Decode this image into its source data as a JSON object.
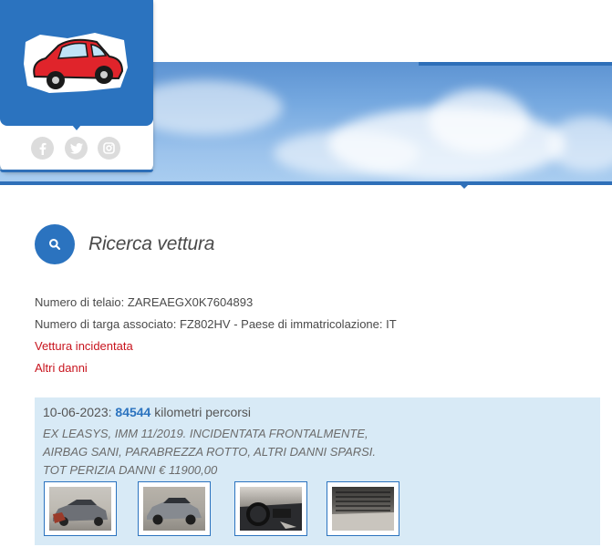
{
  "brand": {
    "logo_icon": "red-car-icon",
    "accent_color": "#2b73bf",
    "alert_color": "#c8141e"
  },
  "social": [
    {
      "icon": "facebook-icon",
      "glyph": "f"
    },
    {
      "icon": "twitter-icon",
      "glyph": "t"
    },
    {
      "icon": "instagram-icon",
      "glyph": "◎"
    }
  ],
  "search": {
    "icon": "search-icon",
    "title": "Ricerca vettura"
  },
  "vehicle": {
    "chassis_line": "Numero di telaio: ZAREAEGX0K7604893",
    "plate_line": "Numero di targa associato: FZ802HV - Paese di immatricolazione: IT",
    "flag_accident": "Vettura incidentata",
    "flag_other_damage": "Altri danni"
  },
  "record": {
    "date": "10-06-2023:",
    "km": "84544",
    "km_label": "kilometri percorsi",
    "desc_line1": "EX LEASYS, IMM 11/2019. INCIDENTATA FRONTALMENTE,",
    "desc_line2": "AIRBAG SANI, PARABREZZA ROTTO, ALTRI DANNI SPARSI.",
    "desc_line3": "TOT PERIZIA DANNI € 11900,00",
    "photos": [
      {
        "name": "photo-front-damage"
      },
      {
        "name": "photo-side-view"
      },
      {
        "name": "photo-interior-dashboard"
      },
      {
        "name": "photo-damaged-panel"
      }
    ]
  }
}
